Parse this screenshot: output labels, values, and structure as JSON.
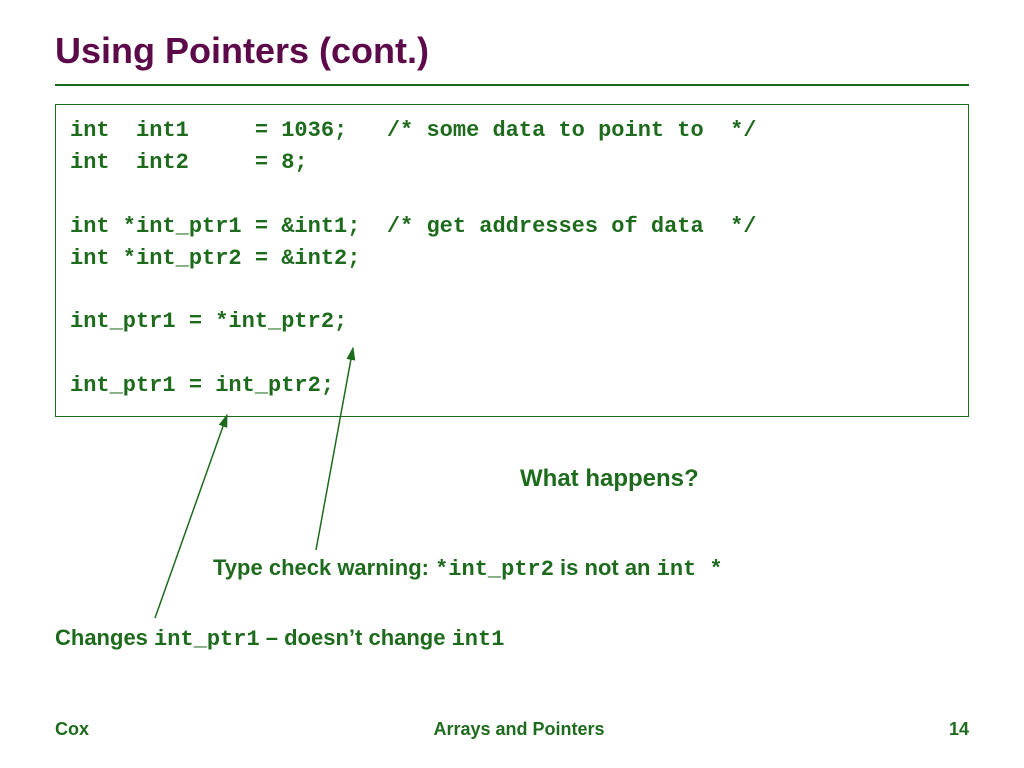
{
  "title": "Using Pointers (cont.)",
  "code": {
    "l1": "int  int1     = 1036;   /* some data to point to  */",
    "l2": "int  int2     = 8;",
    "l3": "",
    "l4": "int *int_ptr1 = &int1;  /* get addresses of data  */",
    "l5": "int *int_ptr2 = &int2;",
    "l6": "",
    "l7": "int_ptr1 = *int_ptr2;",
    "l8": "",
    "l9": "int_ptr1 = int_ptr2;"
  },
  "question": "What happens?",
  "warning": {
    "prefix": "Type check warning:  ",
    "code1": "*int_ptr2",
    "mid": " is not an ",
    "code2": "int *"
  },
  "changes": {
    "prefix": "Changes ",
    "code1": "int_ptr1",
    "mid": " – doesn’t change ",
    "code2": "int1"
  },
  "footer": {
    "left": "Cox",
    "center": "Arrays and Pointers",
    "right": "14"
  }
}
